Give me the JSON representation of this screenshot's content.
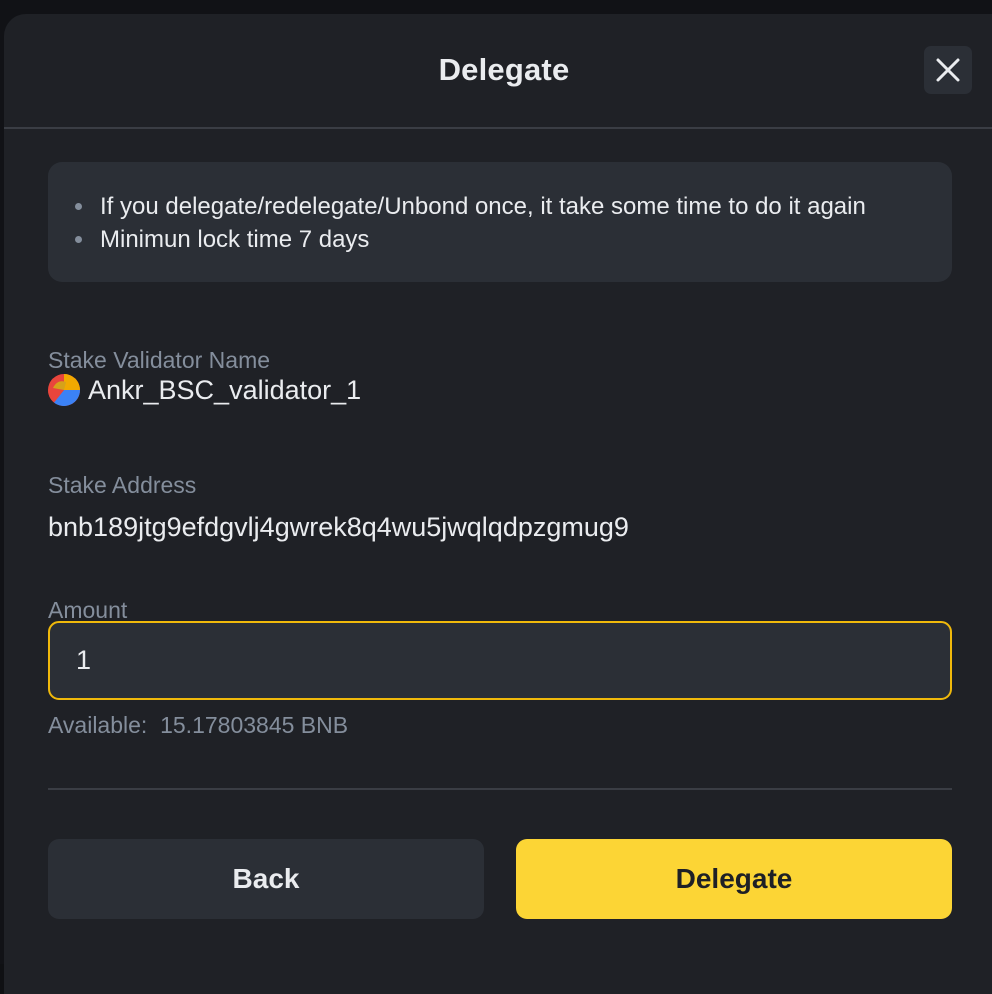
{
  "dialog": {
    "title": "Delegate",
    "close_icon": "close-icon"
  },
  "notice": {
    "items": [
      "If you delegate/redelegate/Unbond once, it take some time to do it again",
      "Minimun lock time 7 days"
    ]
  },
  "validator": {
    "label": "Stake Validator Name",
    "name": "Ankr_BSC_validator_1",
    "logo_icon": "ankr-logo-icon"
  },
  "address": {
    "label": "Stake Address",
    "value": "bnb189jtg9efdgvlj4gwrek8q4wu5jwqlqdpzgmug9"
  },
  "amount": {
    "label": "Amount",
    "value": "1",
    "available_label": "Available:",
    "available_value": "15.17803845 BNB"
  },
  "actions": {
    "back_label": "Back",
    "delegate_label": "Delegate"
  },
  "colors": {
    "accent": "#fcd535",
    "input_border": "#f0b90b",
    "background": "#1f2126",
    "panel": "#2b2f36"
  }
}
